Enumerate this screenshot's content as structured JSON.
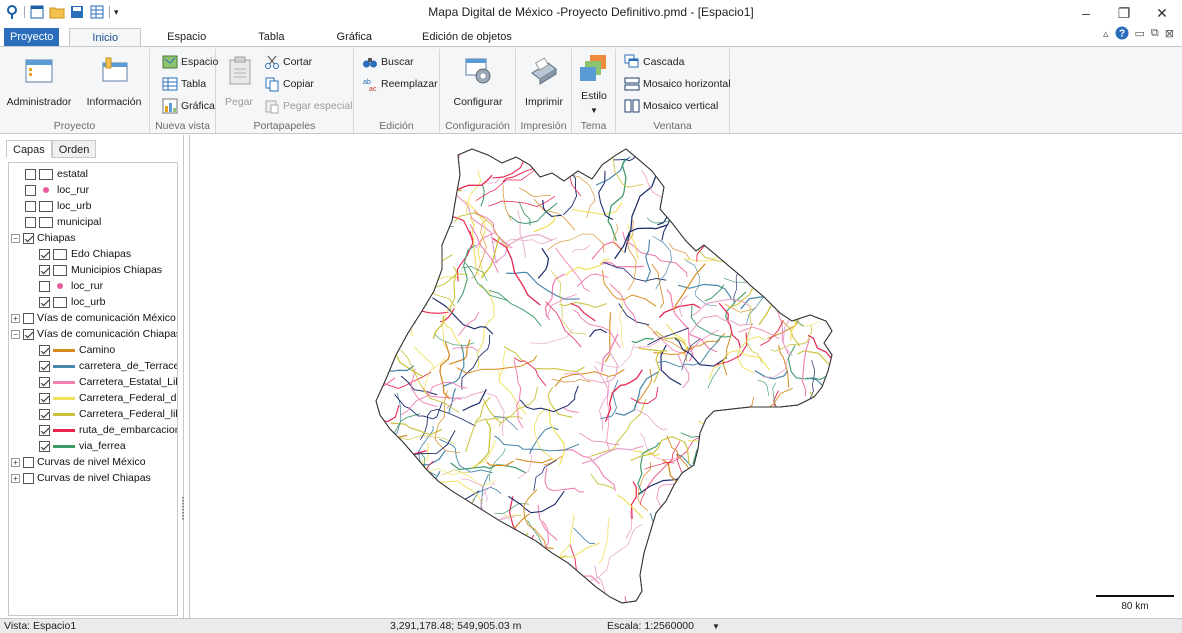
{
  "window": {
    "title": "Mapa Digital de México -Proyecto Definitivo.pmd - [Espacio1]",
    "minimize": "–",
    "restore": "❐",
    "close": "✕"
  },
  "ribbon_tabs": [
    {
      "label": "Proyecto"
    },
    {
      "label": "Inicio"
    },
    {
      "label": "Espacio"
    },
    {
      "label": "Tabla"
    },
    {
      "label": "Gráfica"
    },
    {
      "label": "Edición de objetos"
    }
  ],
  "ribbon": {
    "proyecto": {
      "label": "Proyecto",
      "administrador": "Administrador",
      "informacion": "Información"
    },
    "nueva_vista": {
      "label": "Nueva vista",
      "espacio": "Espacio",
      "tabla": "Tabla",
      "grafica": "Gráfica"
    },
    "portapapeles": {
      "label": "Portapapeles",
      "pegar": "Pegar",
      "cortar": "Cortar",
      "copiar": "Copiar",
      "pegar_especial": "Pegar especial"
    },
    "edicion": {
      "label": "Edición",
      "buscar": "Buscar",
      "reemplazar": "Reemplazar"
    },
    "configuracion": {
      "label": "Configuración",
      "configurar": "Configurar"
    },
    "impresion": {
      "label": "Impresión",
      "imprimir": "Imprimir"
    },
    "tema": {
      "label": "Tema",
      "estilo": "Estilo"
    },
    "ventana": {
      "label": "Ventana",
      "cascada": "Cascada",
      "mosaico_horizontal": "Mosaico horizontal",
      "mosaico_vertical": "Mosaico vertical"
    }
  },
  "panel": {
    "tabs": [
      "Capas",
      "Orden"
    ],
    "layers": [
      {
        "label": "estatal",
        "indent": 1,
        "checked": false,
        "sym": "box"
      },
      {
        "label": "loc_rur",
        "indent": 1,
        "checked": false,
        "sym": "dot"
      },
      {
        "label": "loc_urb",
        "indent": 1,
        "checked": false,
        "sym": "box"
      },
      {
        "label": "municipal",
        "indent": 1,
        "checked": false,
        "sym": "box"
      },
      {
        "label": "Chiapas",
        "indent": 0,
        "checked": true,
        "sym": "none",
        "expander": "−"
      },
      {
        "label": "Edo Chiapas",
        "indent": 2,
        "checked": true,
        "sym": "box"
      },
      {
        "label": "Municipios Chiapas",
        "indent": 2,
        "checked": true,
        "sym": "box"
      },
      {
        "label": "loc_rur",
        "indent": 2,
        "checked": false,
        "sym": "dot"
      },
      {
        "label": "loc_urb",
        "indent": 2,
        "checked": true,
        "sym": "box"
      },
      {
        "label": "Vías de comunicación México",
        "indent": 0,
        "checked": false,
        "sym": "none",
        "expander": "+"
      },
      {
        "label": "Vías de comunicación Chiapas",
        "indent": 0,
        "checked": true,
        "sym": "none",
        "expander": "−"
      },
      {
        "label": "Camino",
        "indent": 2,
        "checked": true,
        "sym": "line",
        "color": "#d68a1d"
      },
      {
        "label": "carretera_de_Terraceria",
        "indent": 2,
        "checked": true,
        "sym": "line",
        "color": "#4a86a8"
      },
      {
        "label": "Carretera_Estatal_Libre",
        "indent": 2,
        "checked": true,
        "sym": "line",
        "color": "#f07fb3"
      },
      {
        "label": "Carretera_Federal_de_C",
        "indent": 2,
        "checked": true,
        "sym": "line",
        "color": "#f0e05a"
      },
      {
        "label": "Carretera_Federal_libre",
        "indent": 2,
        "checked": true,
        "sym": "line",
        "color": "#c9c23a"
      },
      {
        "label": "ruta_de_embarcacion-a",
        "indent": 2,
        "checked": true,
        "sym": "line",
        "color": "#e8234f"
      },
      {
        "label": "via_ferrea",
        "indent": 2,
        "checked": true,
        "sym": "line",
        "color": "#3f9a6a"
      },
      {
        "label": "Curvas de nivel México",
        "indent": 0,
        "checked": false,
        "sym": "none",
        "expander": "+"
      },
      {
        "label": "Curvas de nivel Chiapas",
        "indent": 0,
        "checked": false,
        "sym": "none",
        "expander": "+"
      }
    ]
  },
  "map": {
    "scale_label": "80 km",
    "road_colors": [
      "#d68a1d",
      "#4a86a8",
      "#f07fb3",
      "#f0e05a",
      "#c9c23a",
      "#e8234f",
      "#3f9a6a",
      "#1b2a6b",
      "#e6a3c9"
    ]
  },
  "status": {
    "vista": "Vista: Espacio1",
    "coords": "3,291,178.48; 549,905.03 m",
    "escala": "Escala: 1:2560000"
  }
}
